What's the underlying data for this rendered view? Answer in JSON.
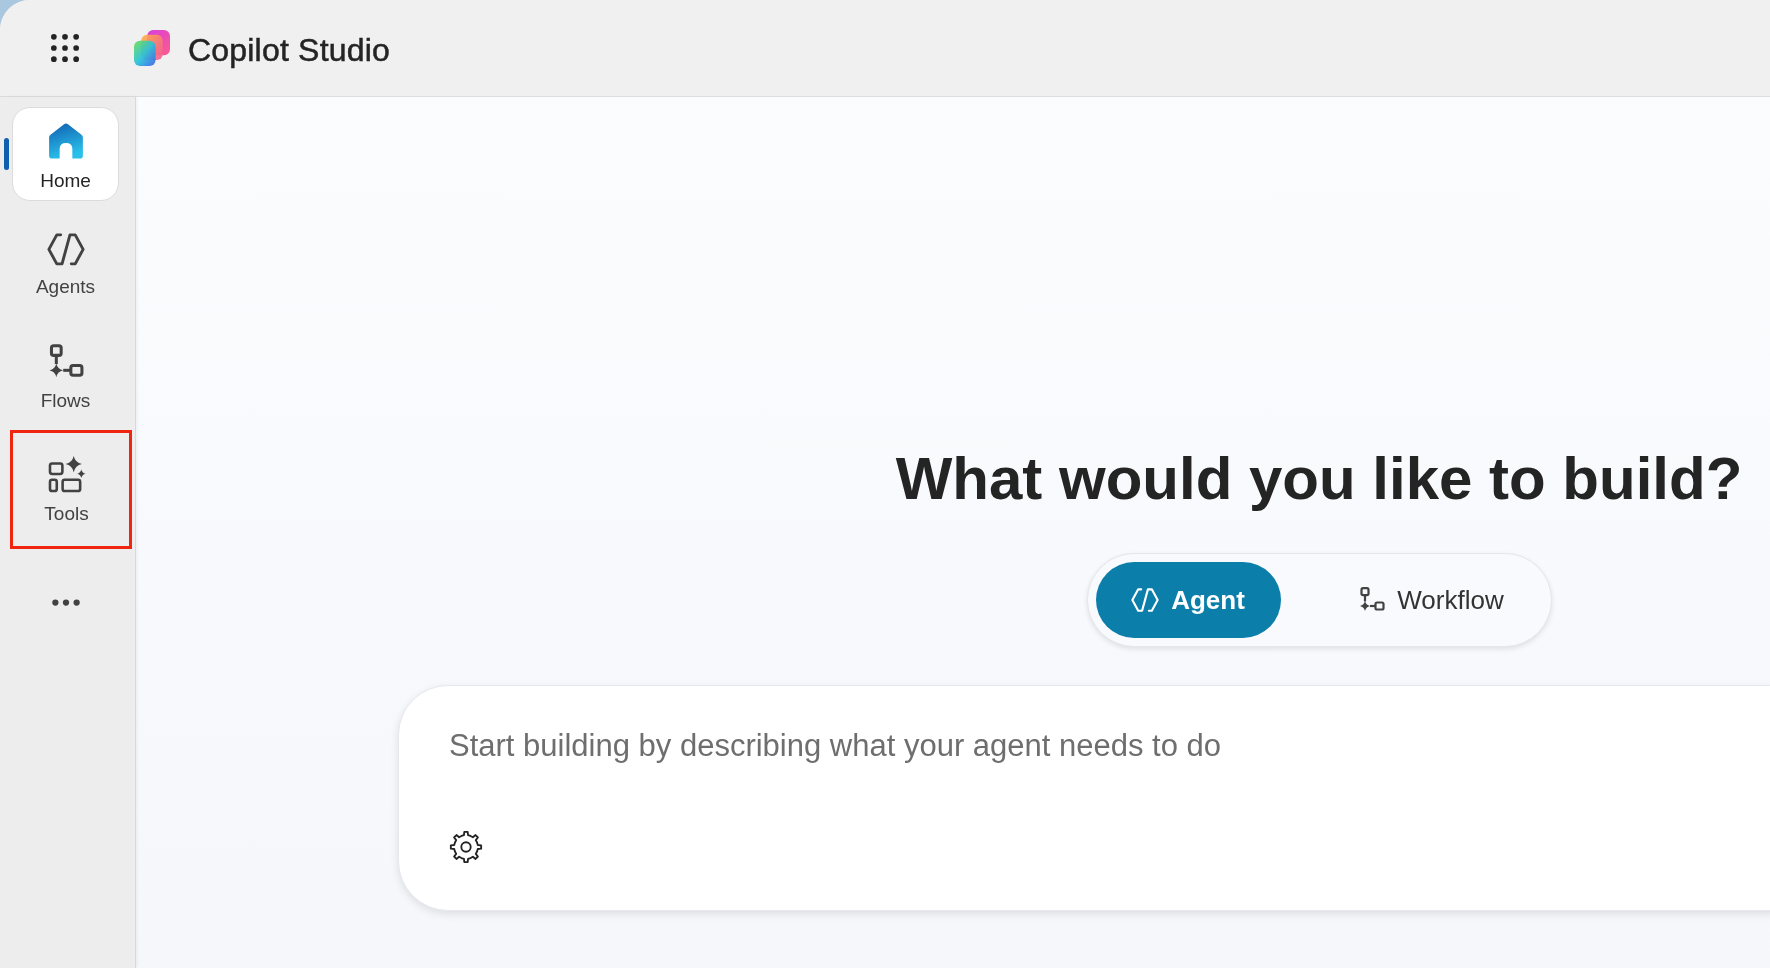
{
  "header": {
    "title": "Copilot Studio"
  },
  "sidebar": {
    "items": [
      {
        "label": "Home",
        "selected": true,
        "highlighted": false
      },
      {
        "label": "Agents",
        "selected": false,
        "highlighted": false
      },
      {
        "label": "Flows",
        "selected": false,
        "highlighted": false
      },
      {
        "label": "Tools",
        "selected": false,
        "highlighted": true
      }
    ]
  },
  "main": {
    "heading": "What would you like to build?",
    "mode_toggle": {
      "options": [
        {
          "label": "Agent",
          "selected": true
        },
        {
          "label": "Workflow",
          "selected": false
        }
      ]
    },
    "prompt": {
      "placeholder": "Start building by describing what your agent needs to do"
    }
  }
}
